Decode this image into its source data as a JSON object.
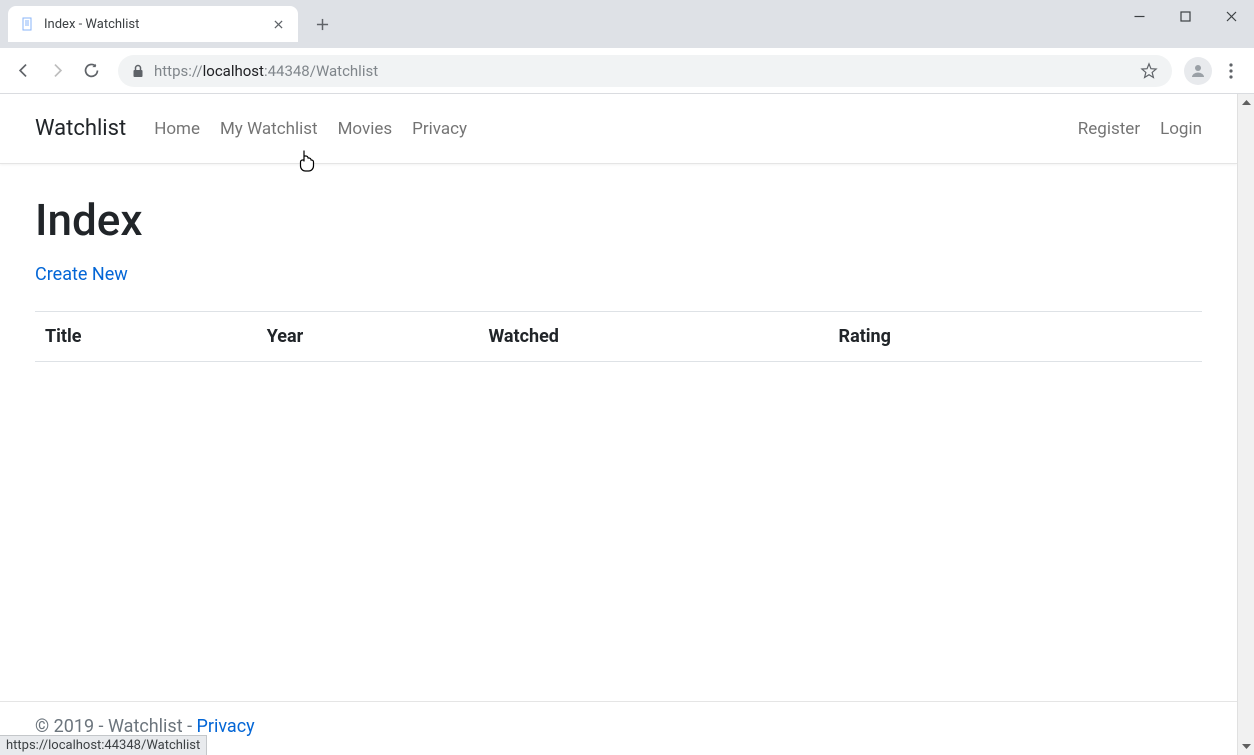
{
  "browser": {
    "tab_title": "Index - Watchlist",
    "url_scheme": "https://",
    "url_host_prefix": "localhost",
    "url_host_port": ":44348",
    "url_path": "/Watchlist",
    "status_bar": "https://localhost:44348/Watchlist"
  },
  "nav": {
    "brand": "Watchlist",
    "links": [
      "Home",
      "My Watchlist",
      "Movies",
      "Privacy"
    ],
    "right": [
      "Register",
      "Login"
    ]
  },
  "page": {
    "heading": "Index",
    "create_link": "Create New",
    "columns": [
      "Title",
      "Year",
      "Watched",
      "Rating"
    ]
  },
  "footer": {
    "copyright": "© 2019 - Watchlist - ",
    "privacy": "Privacy"
  }
}
